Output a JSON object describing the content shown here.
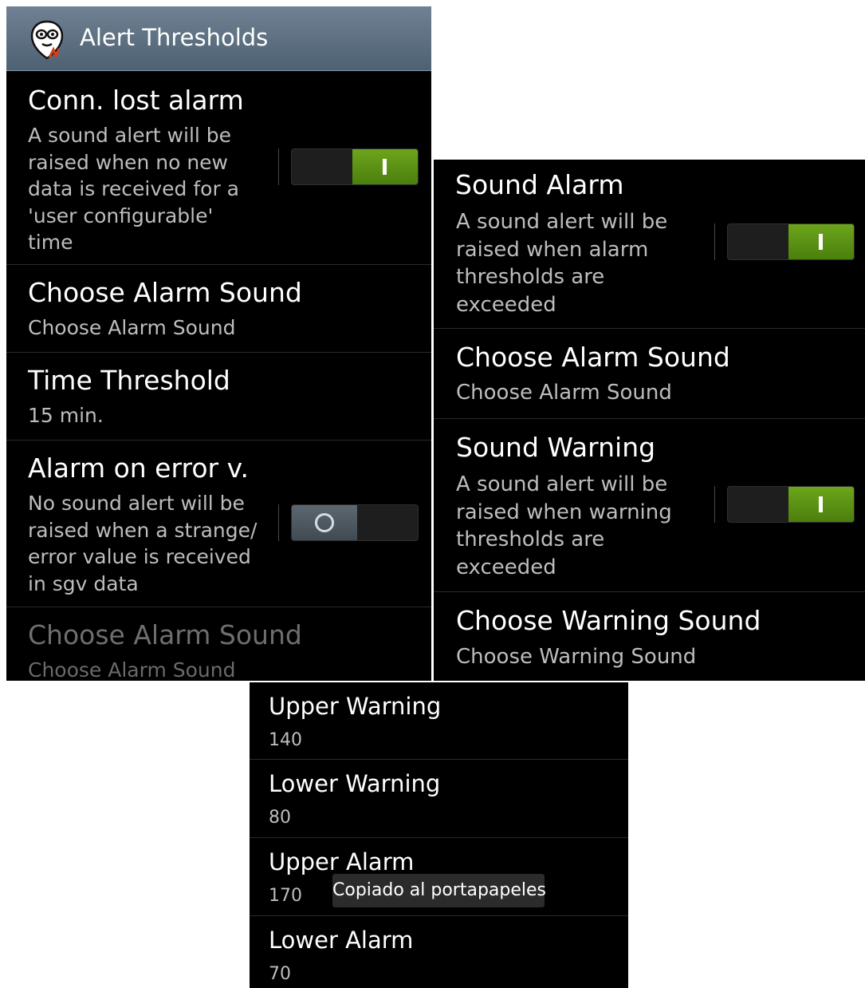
{
  "left_panel": {
    "action_bar": {
      "icon": "alien-face-icon",
      "title": "Alert Thresholds"
    },
    "items": [
      {
        "title": "Conn. lost alarm",
        "summary_lines": [
          "A sound alert will be",
          "raised when no new",
          "data is received for a",
          "'user configurable'",
          "time"
        ],
        "switch": "on"
      },
      {
        "title": "Choose Alarm Sound",
        "summary": "Choose Alarm Sound"
      },
      {
        "title": "Time Threshold",
        "summary": "15 min."
      },
      {
        "title": "Alarm on error v.",
        "summary_lines": [
          "No sound alert will be",
          "raised when a strange/",
          "error value is received",
          "in sgv data"
        ],
        "switch": "off"
      },
      {
        "title": "Choose Alarm Sound",
        "summary": "Choose Alarm Sound",
        "enabled": false
      }
    ]
  },
  "right_panel": {
    "items": [
      {
        "title": "Sound Alarm",
        "summary_lines": [
          "A sound alert will be",
          "raised when alarm",
          "thresholds are",
          "exceeded"
        ],
        "switch": "on"
      },
      {
        "title": "Choose Alarm Sound",
        "summary": "Choose Alarm Sound"
      },
      {
        "title": "Sound Warning",
        "summary_lines": [
          "A sound alert will be",
          "raised when warning",
          "thresholds are",
          "exceeded"
        ],
        "switch": "on"
      },
      {
        "title": "Choose Warning Sound",
        "summary": "Choose Warning Sound"
      }
    ]
  },
  "bottom_panel": {
    "items": [
      {
        "title": "Upper Warning",
        "value": "140"
      },
      {
        "title": "Lower Warning",
        "value": "80"
      },
      {
        "title": "Upper Alarm",
        "value": "170"
      },
      {
        "title": "Lower Alarm",
        "value": "70"
      }
    ],
    "toast": "Copiado al portapapeles"
  },
  "colors": {
    "background": "#000000",
    "action_bar": "#5d6f81",
    "switch_on": "#5e9616",
    "switch_off_thumb": "#4f5a63",
    "primary_text": "#ffffff",
    "secondary_text": "#bdbdbd",
    "disabled_text": "#6e6e6e"
  }
}
